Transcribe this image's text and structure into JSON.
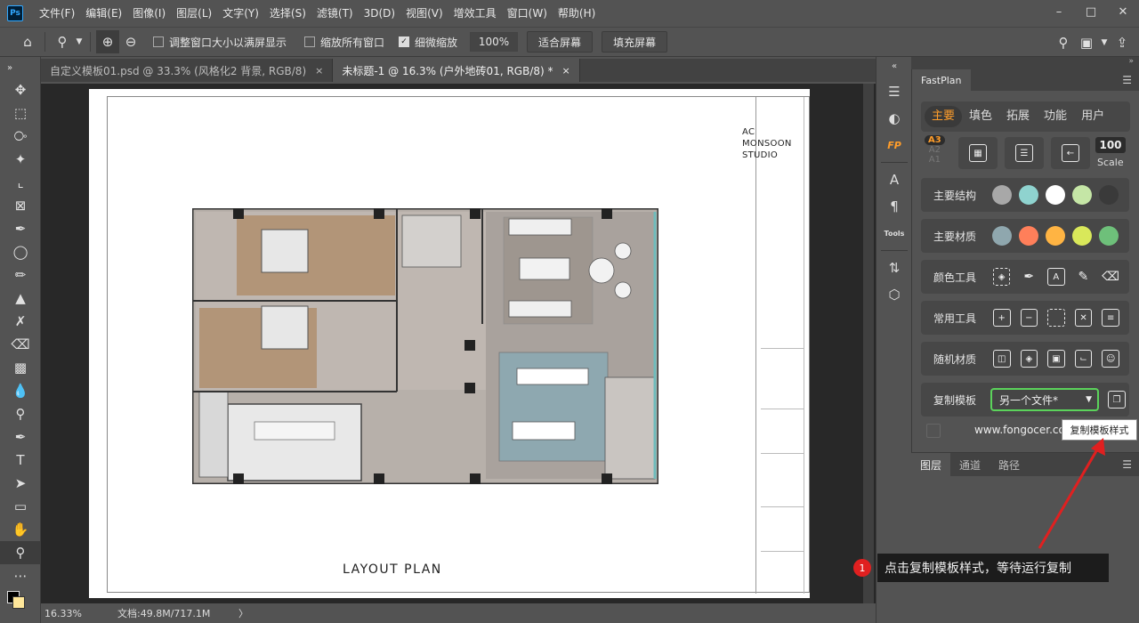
{
  "app": {
    "logo": "Ps"
  },
  "menu": [
    "文件(F)",
    "编辑(E)",
    "图像(I)",
    "图层(L)",
    "文字(Y)",
    "选择(S)",
    "滤镜(T)",
    "3D(D)",
    "视图(V)",
    "增效工具",
    "窗口(W)",
    "帮助(H)"
  ],
  "options": {
    "resize_windows": "调整窗口大小以满屏显示",
    "zoom_all": "缩放所有窗口",
    "scrubby_zoom": "细微缩放",
    "zoom_value": "100%",
    "fit_screen": "适合屏幕",
    "fill_screen": "填充屏幕"
  },
  "tabs": [
    {
      "label": "自定义模板01.psd @ 33.3% (风格化2 背景, RGB/8)",
      "close": "×"
    },
    {
      "label": "未标题-1 @ 16.3% (户外地砖01, RGB/8) *",
      "close": "×"
    }
  ],
  "document": {
    "studio": [
      "AC",
      "MONSOON",
      "STUDIO"
    ],
    "plan_title": "LAYOUT PLAN"
  },
  "status": {
    "zoom": "16.33%",
    "doc": "文档:49.8M/717.1M",
    "arrow": "〉"
  },
  "dock": {
    "fp_label": "FP",
    "tools_label": "Tools"
  },
  "fastplan": {
    "panel_title": "FastPlan",
    "nav": [
      "主要",
      "填色",
      "拓展",
      "功能",
      "用户"
    ],
    "paper_sizes": [
      "A3",
      "A2",
      "A1"
    ],
    "scale_value": "100",
    "scale_label": "Scale",
    "rows": {
      "structure": "主要结构",
      "materials": "主要材质",
      "color_tools": "颜色工具",
      "common_tools": "常用工具",
      "random_material": "随机材质",
      "copy_template": "复制模板"
    },
    "structure_colors": [
      "#a8a8a8",
      "#8fd3cf",
      "#ffffff",
      "#c5e6a6",
      "#3a3a3a"
    ],
    "material_colors": [
      "#8fa7ae",
      "#ff7f5a",
      "#ffb443",
      "#d9e85a",
      "#6ec07a"
    ],
    "template_select": "另一个文件*",
    "website": "www.fongocer.com"
  },
  "layers": {
    "tabs": [
      "图层",
      "通道",
      "路径"
    ]
  },
  "annotations": {
    "tooltip": "复制模板样式",
    "badge": "1",
    "callout": "点击复制模板样式，等待运行复制"
  }
}
